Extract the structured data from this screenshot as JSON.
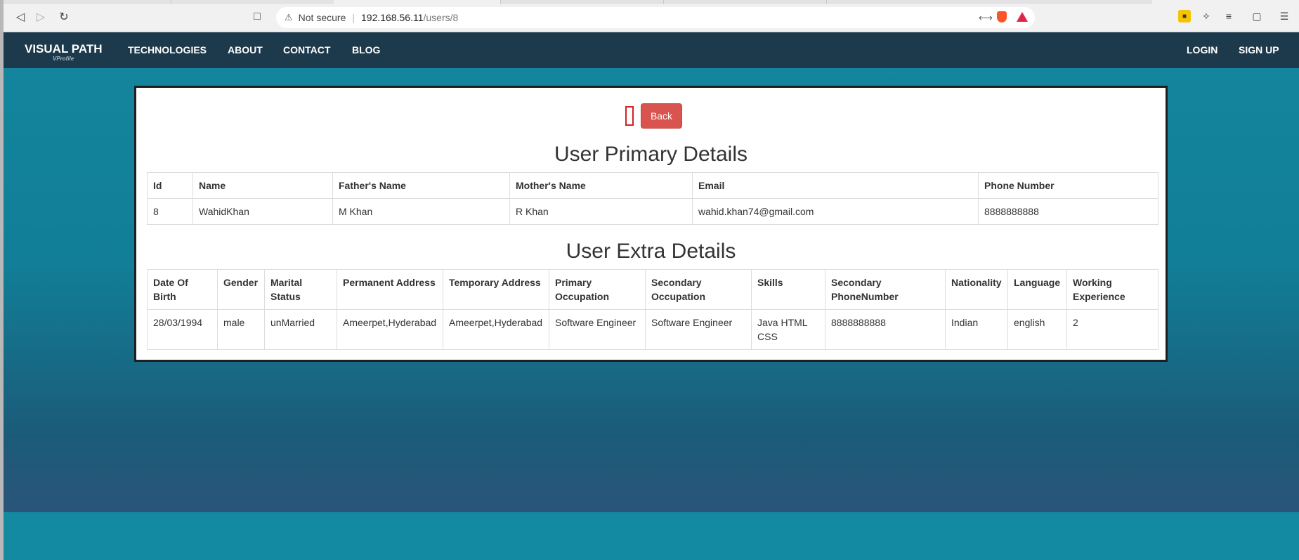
{
  "browser": {
    "not_secure": "Not secure",
    "url_host": "192.168.56.11",
    "url_path": "/users/8"
  },
  "site": {
    "brand": "VISUAL PATH",
    "brand_sub": "VProfile",
    "nav": [
      "TECHNOLOGIES",
      "ABOUT",
      "CONTACT",
      "BLOG"
    ],
    "login": "LOGIN",
    "signup": "SIGN UP"
  },
  "page": {
    "back_label": "Back",
    "primary_title": "User Primary Details",
    "extra_title": "User Extra Details"
  },
  "primary": {
    "headers": [
      "Id",
      "Name",
      "Father's Name",
      "Mother's Name",
      "Email",
      "Phone Number"
    ],
    "row": [
      "8",
      "WahidKhan",
      "M Khan",
      "R Khan",
      "wahid.khan74@gmail.com",
      "8888888888"
    ]
  },
  "extra": {
    "headers": [
      "Date Of Birth",
      "Gender",
      "Marital Status",
      "Permanent Address",
      "Temporary Address",
      "Primary Occupation",
      "Secondary Occupation",
      "Skills",
      "Secondary PhoneNumber",
      "Nationality",
      "Language",
      "Working Experience"
    ],
    "row": [
      "28/03/1994",
      "male",
      "unMarried",
      "Ameerpet,Hyderabad",
      "Ameerpet,Hyderabad",
      "Software Engineer",
      "Software Engineer",
      "Java HTML CSS",
      "8888888888",
      "Indian",
      "english",
      "2"
    ]
  },
  "colors": {
    "navbar": "#1d3a4c",
    "back_button": "#d9534f",
    "background": "#13859c"
  }
}
